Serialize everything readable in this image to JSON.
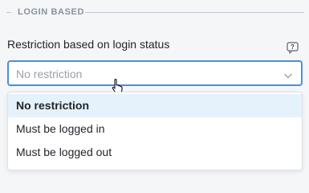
{
  "section": {
    "title": "LOGIN BASED"
  },
  "field": {
    "label": "Restriction based on login status",
    "placeholder": "No restriction"
  },
  "icons": {
    "help": "question-bubble-icon",
    "chevron": "chevron-down-icon"
  },
  "options": [
    {
      "label": "No restriction",
      "selected": true
    },
    {
      "label": "Must be logged in",
      "selected": false
    },
    {
      "label": "Must be logged out",
      "selected": false
    }
  ],
  "colors": {
    "accent": "#4a8fdc",
    "selected_bg": "#e6f2fb"
  }
}
